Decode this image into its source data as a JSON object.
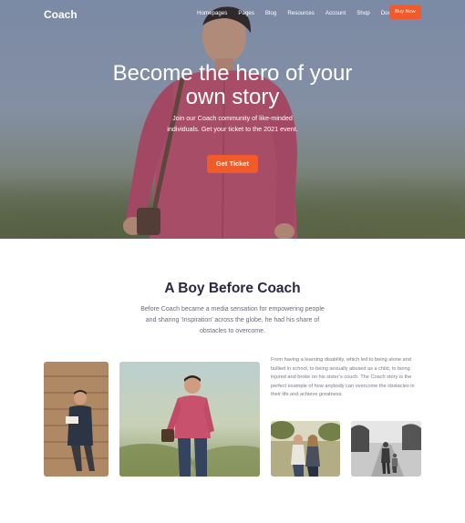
{
  "nav": {
    "brand": "Coach",
    "links": [
      "Homepages",
      "Pages",
      "Blog",
      "Resources",
      "Account",
      "Shop",
      "Docs"
    ],
    "buy_label": "Buy Now"
  },
  "hero": {
    "title_line1": "Become the hero of your",
    "title_line2": "own story",
    "subtitle": "Join our Coach community of like-minded individuals. Get your ticket to the 2021 event.",
    "cta_label": "Get Ticket"
  },
  "about": {
    "title": "A Boy Before Coach",
    "intro": "Before Coach became a media sensation for empowering people and sharing ‘Inspiration’ across the globe, he had his share of obstacles to overcome.",
    "story": "From having a learning disability, which led to being alone and bullied in school, to being sexually abused as a child, to being injured and broke on his sister’s couch. The Coach story is the perfect example of how anybody can overcome the obstacles in their life and achieve greatness."
  },
  "colors": {
    "accent": "#f15a2b",
    "heading": "#2a2741",
    "body_text": "#6b6a7b"
  }
}
